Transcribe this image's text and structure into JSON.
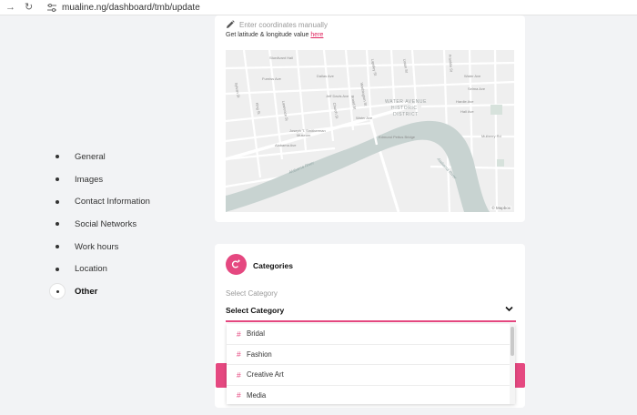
{
  "browser": {
    "url": "mualine.ng/dashboard/tmb/update",
    "icons": [
      "forward-arrow-icon",
      "reload-icon",
      "site-settings-icon"
    ]
  },
  "sidebar": {
    "items": [
      {
        "label": "General",
        "active": false
      },
      {
        "label": "Images",
        "active": false
      },
      {
        "label": "Contact Information",
        "active": false
      },
      {
        "label": "Social Networks",
        "active": false
      },
      {
        "label": "Work hours",
        "active": false
      },
      {
        "label": "Location",
        "active": false
      },
      {
        "label": "Other",
        "active": true
      }
    ]
  },
  "location": {
    "manual_entry": "Enter coordinates manually",
    "help_text": "Get latitude & longitude value",
    "help_link": "here",
    "map": {
      "district": [
        "WATER AVENUE",
        "HISTORIC",
        "DISTRICT"
      ],
      "river": "Alabama River",
      "credit": "© Mapbox",
      "places": [
        "Sturdivant Hall",
        "Joseph T. Smitherman",
        "Museum",
        "Edmund Pettus Bridge"
      ],
      "streets": [
        "Water Ave",
        "Furniss Ave",
        "Alabama Ave",
        "Selma Ave",
        "Dallas Ave",
        "Jeff Davis Ave",
        "Mulberry Rd",
        "Hardie Ave",
        "Hall Ave",
        "Lawrence St",
        "Broad St",
        "Church St",
        "Sylvan St",
        "King St",
        "Lapsley St",
        "Union St",
        "Franklin St",
        "Washington St"
      ]
    }
  },
  "categories": {
    "title": "Categories",
    "select_label": "Select Category",
    "select_value": "Select Category",
    "options": [
      "Bridal",
      "Fashion",
      "Creative Art",
      "Media"
    ]
  },
  "colors": {
    "accent": "#e54880",
    "background": "#f2f3f5",
    "card": "#ffffff",
    "river": "#c8d3d1"
  }
}
